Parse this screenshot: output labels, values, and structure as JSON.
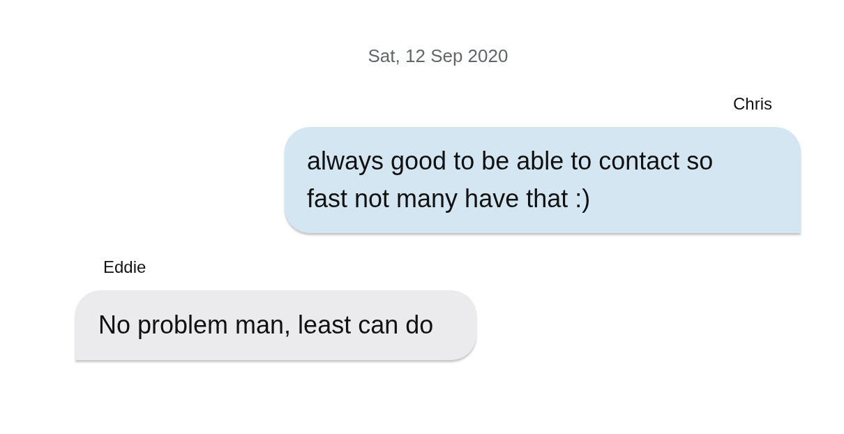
{
  "date_separator": "Sat, 12 Sep 2020",
  "messages": [
    {
      "kind": "outgoing",
      "sender": "Chris",
      "text": "always good to be able to contact so fast not many have that :)"
    },
    {
      "kind": "incoming",
      "sender": "Eddie",
      "text": "No problem man, least can do"
    }
  ]
}
